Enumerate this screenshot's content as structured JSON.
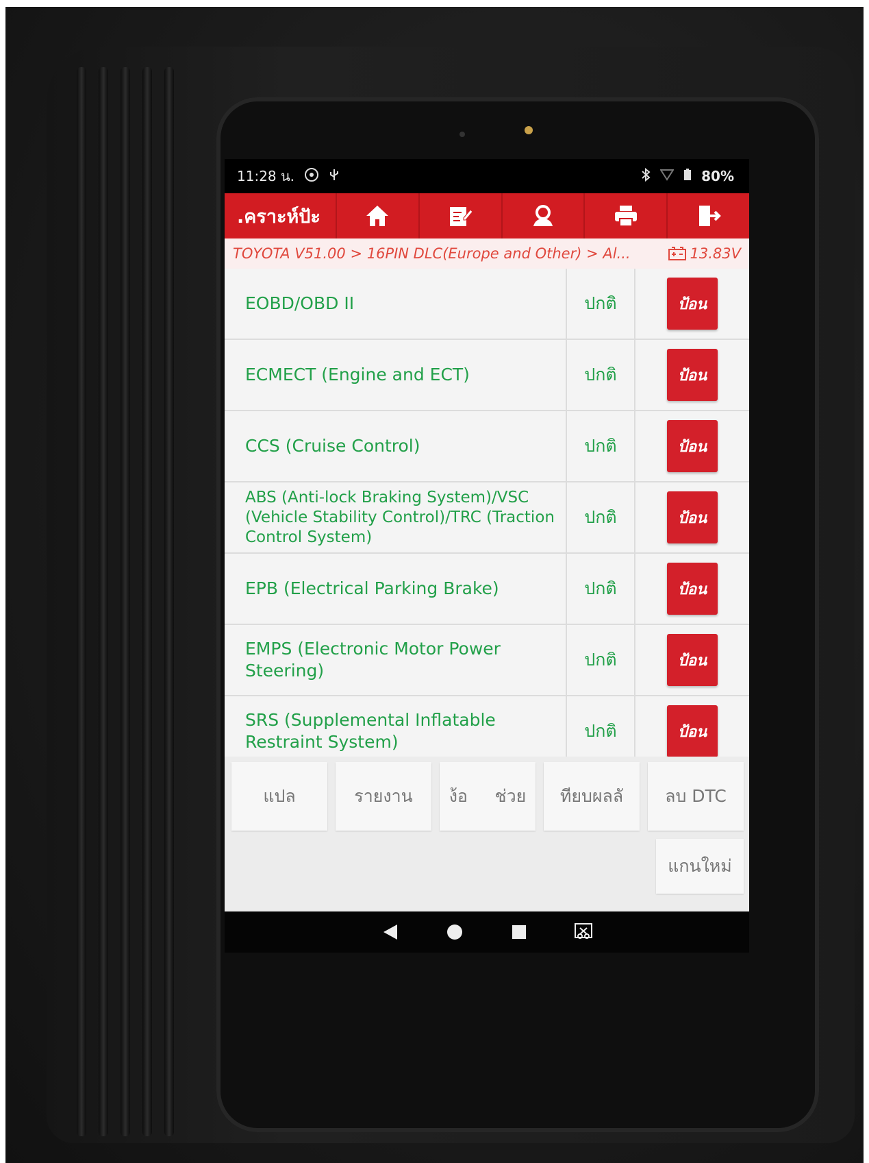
{
  "status_bar": {
    "time": "11:28 น.",
    "battery": "80%"
  },
  "app_bar": {
    "title": ".คราะห์ปัะ",
    "buttons": [
      "home-icon",
      "edit-report-icon",
      "user-icon",
      "printer-icon",
      "exit-icon"
    ]
  },
  "breadcrumb": {
    "path": "TOYOTA V51.00 > 16PIN DLC(Europe and Other) > Al...",
    "voltage": "13.83V"
  },
  "systems": [
    {
      "name": "EOBD/OBD II",
      "status": "ปกติ",
      "action": "ป้อน"
    },
    {
      "name": "ECMECT (Engine and ECT)",
      "status": "ปกติ",
      "action": "ป้อน"
    },
    {
      "name": "CCS (Cruise Control)",
      "status": "ปกติ",
      "action": "ป้อน"
    },
    {
      "name": "ABS (Anti-lock Braking System)/VSC (Vehicle Stability Control)/TRC (Traction Control System)",
      "status": "ปกติ",
      "action": "ป้อน"
    },
    {
      "name": "EPB (Electrical Parking Brake)",
      "status": "ปกติ",
      "action": "ป้อน"
    },
    {
      "name": "EMPS (Electronic Motor Power Steering)",
      "status": "ปกติ",
      "action": "ป้อน"
    },
    {
      "name": "SRS (Supplemental Inflatable Restraint System)",
      "status": "ปกติ",
      "action": "ป้อน"
    }
  ],
  "bottom_buttons": {
    "translate": "แปล",
    "report": "รายงาน",
    "help": "ง้อ     ช่วย",
    "compare": "ทียบผลลั",
    "clear_dtc": "ลบ DTC",
    "rescan": "แกนใหม่"
  },
  "colors": {
    "accent_red": "#d21c22",
    "text_green": "#22a049"
  }
}
